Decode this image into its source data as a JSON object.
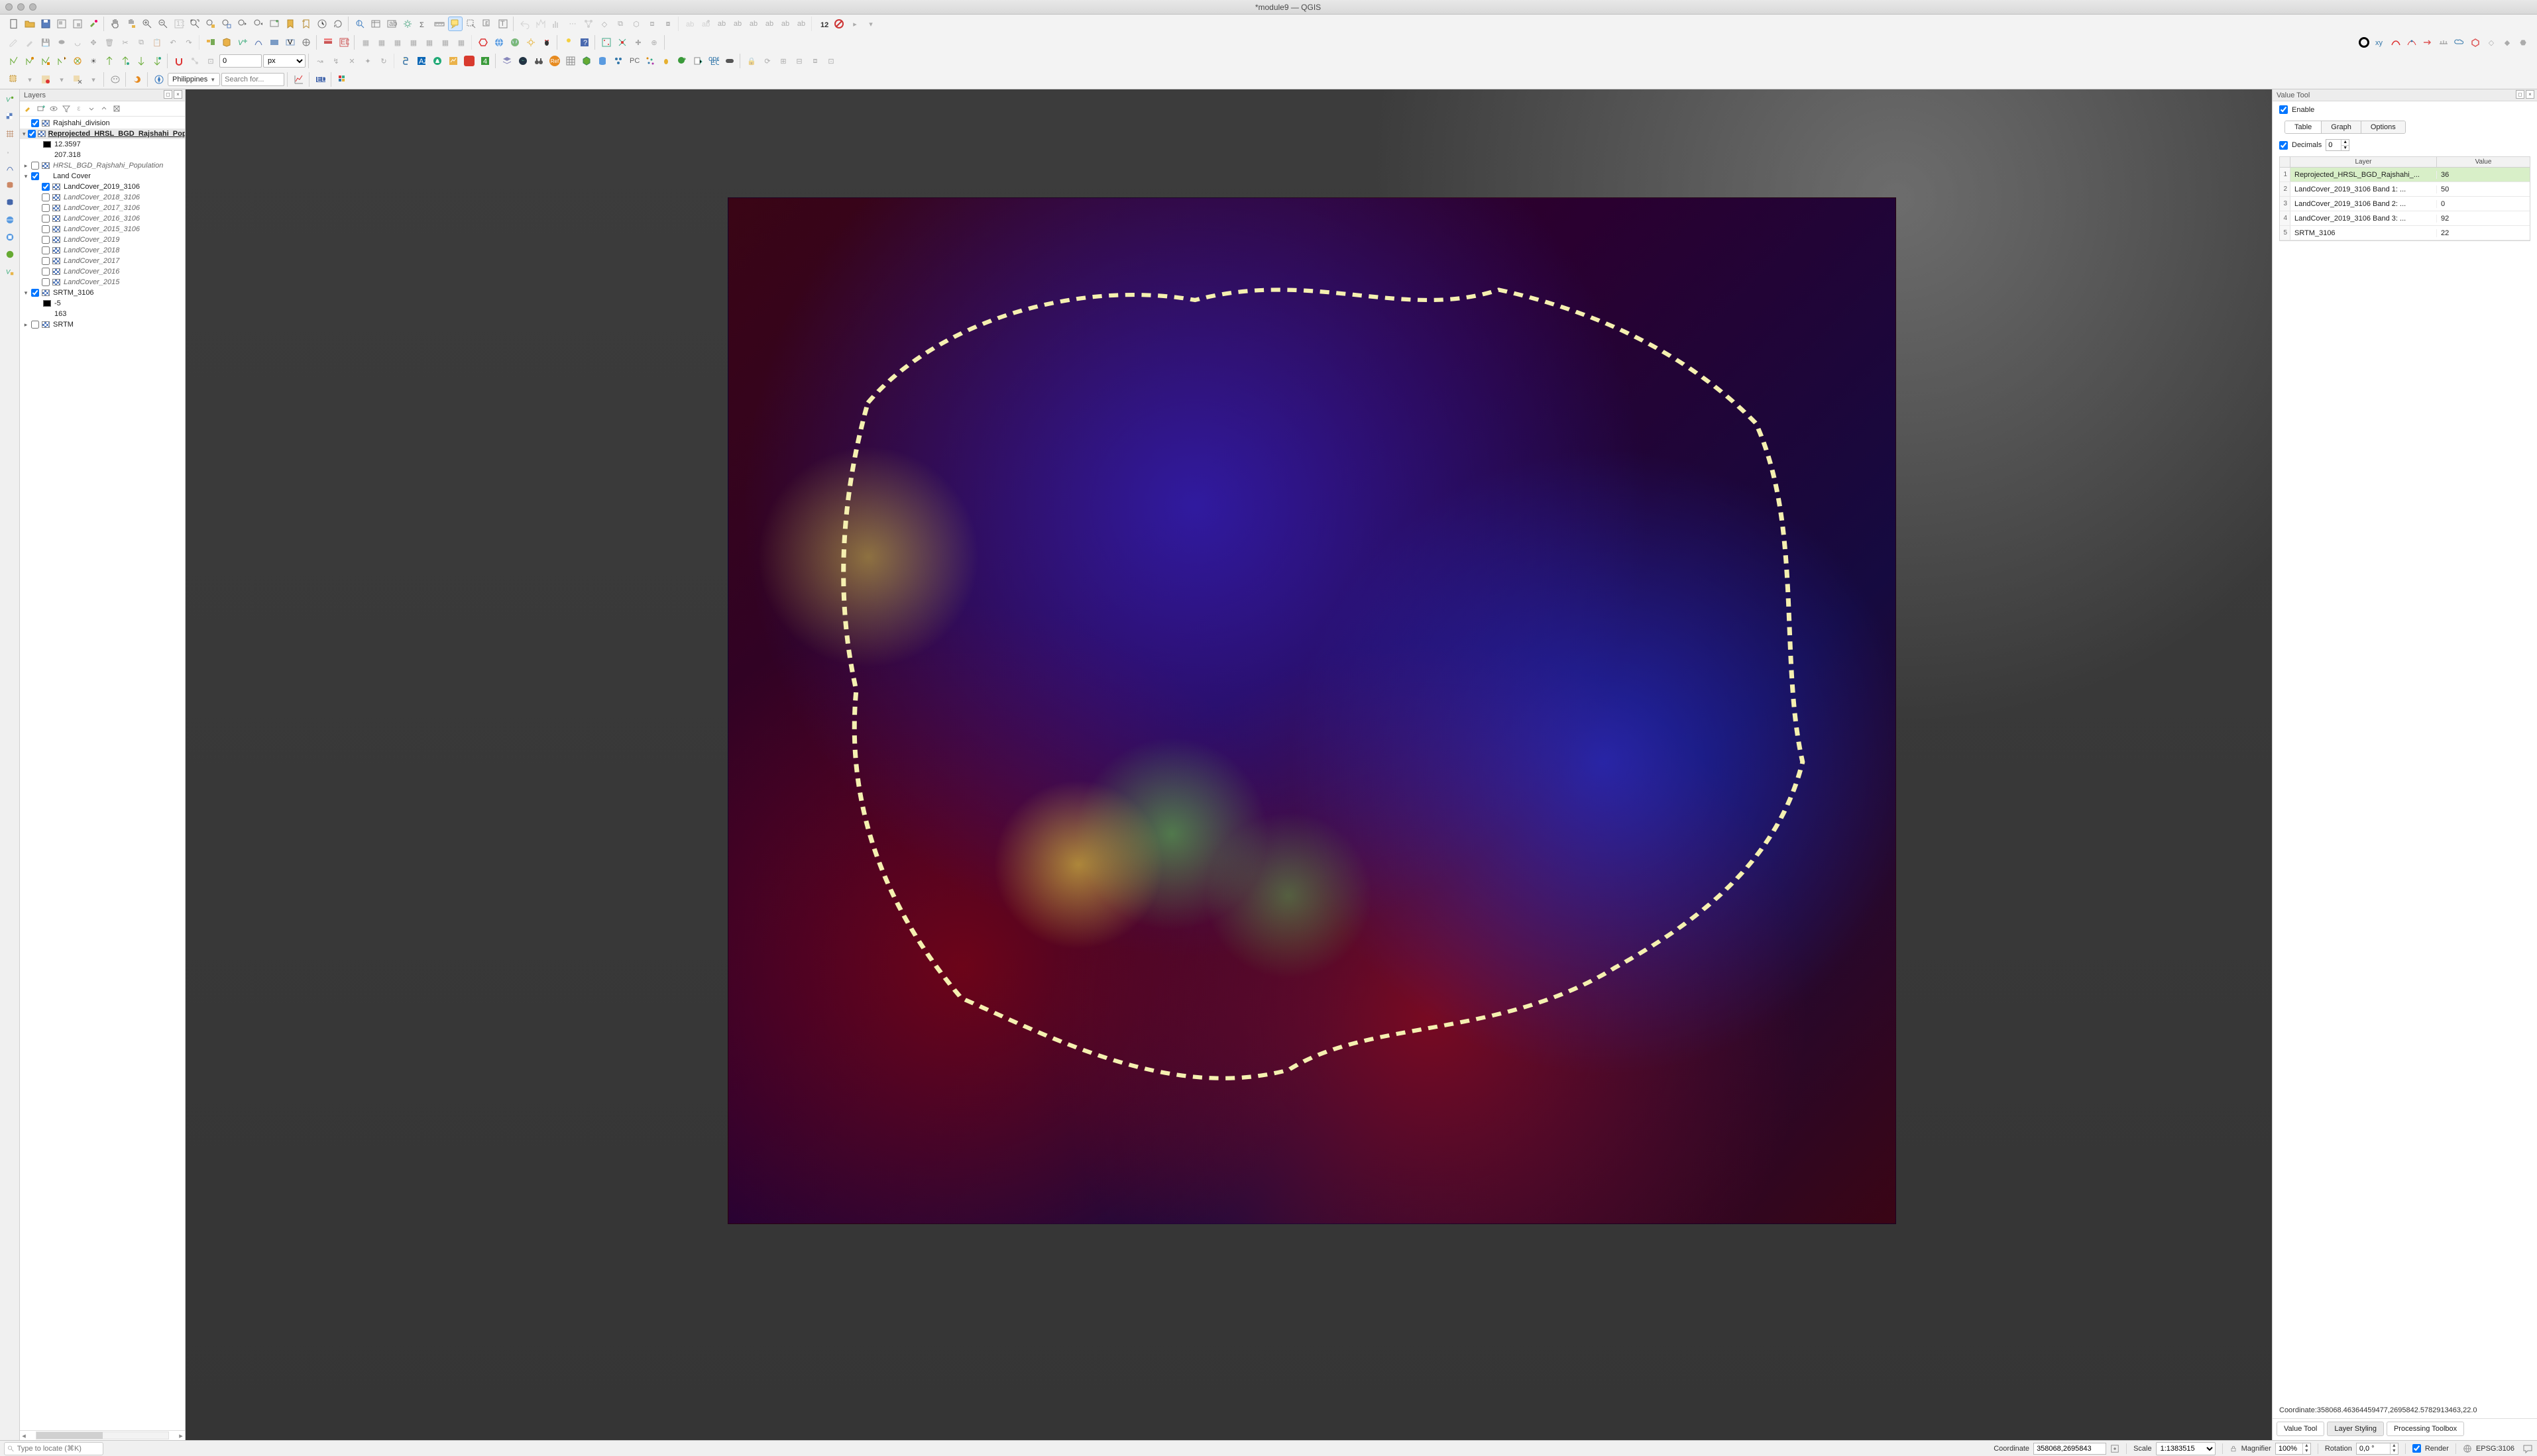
{
  "window": {
    "title": "*module9 — QGIS"
  },
  "toolbar4": {
    "num_input": "0",
    "unit": "px",
    "geom_filter": "Philippines",
    "search_placeholder": "Search for..."
  },
  "layers_panel": {
    "title": "Layers",
    "tree": [
      {
        "kind": "layer",
        "exp": "",
        "chk": true,
        "sym": "raster",
        "label": "Rajshahi_division",
        "cls": ""
      },
      {
        "kind": "layer",
        "exp": "▾",
        "chk": true,
        "sym": "raster",
        "label": "Reprojected_HRSL_BGD_Rajshahi_Population",
        "cls": "selected"
      },
      {
        "kind": "value",
        "swatch": "#000000",
        "label": "12.3597",
        "cls": "child2"
      },
      {
        "kind": "value",
        "swatch": "",
        "label": "207.318",
        "cls": "child2"
      },
      {
        "kind": "layer",
        "exp": "▸",
        "chk": false,
        "sym": "raster",
        "label": "HRSL_BGD_Rajshahi_Population",
        "cls": "italic"
      },
      {
        "kind": "group",
        "exp": "▾",
        "chk": true,
        "sym": "",
        "label": "Land Cover",
        "cls": ""
      },
      {
        "kind": "layer",
        "exp": "",
        "chk": true,
        "sym": "raster",
        "label": "LandCover_2019_3106",
        "cls": "child1"
      },
      {
        "kind": "layer",
        "exp": "",
        "chk": false,
        "sym": "raster",
        "label": "LandCover_2018_3106",
        "cls": "child1 italic"
      },
      {
        "kind": "layer",
        "exp": "",
        "chk": false,
        "sym": "raster",
        "label": "LandCover_2017_3106",
        "cls": "child1 italic"
      },
      {
        "kind": "layer",
        "exp": "",
        "chk": false,
        "sym": "raster",
        "label": "LandCover_2016_3106",
        "cls": "child1 italic"
      },
      {
        "kind": "layer",
        "exp": "",
        "chk": false,
        "sym": "raster",
        "label": "LandCover_2015_3106",
        "cls": "child1 italic"
      },
      {
        "kind": "layer",
        "exp": "",
        "chk": false,
        "sym": "raster",
        "label": "LandCover_2019",
        "cls": "child1 italic"
      },
      {
        "kind": "layer",
        "exp": "",
        "chk": false,
        "sym": "raster",
        "label": "LandCover_2018",
        "cls": "child1 italic"
      },
      {
        "kind": "layer",
        "exp": "",
        "chk": false,
        "sym": "raster",
        "label": "LandCover_2017",
        "cls": "child1 italic"
      },
      {
        "kind": "layer",
        "exp": "",
        "chk": false,
        "sym": "raster",
        "label": "LandCover_2016",
        "cls": "child1 italic"
      },
      {
        "kind": "layer",
        "exp": "",
        "chk": false,
        "sym": "raster",
        "label": "LandCover_2015",
        "cls": "child1 italic"
      },
      {
        "kind": "layer",
        "exp": "▾",
        "chk": true,
        "sym": "raster",
        "label": "SRTM_3106",
        "cls": ""
      },
      {
        "kind": "value",
        "swatch": "#000000",
        "label": "-5",
        "cls": "child2"
      },
      {
        "kind": "value",
        "swatch": "",
        "label": "163",
        "cls": "child2"
      },
      {
        "kind": "layer",
        "exp": "▸",
        "chk": false,
        "sym": "raster",
        "label": "SRTM",
        "cls": ""
      }
    ]
  },
  "value_tool": {
    "title": "Value Tool",
    "enable": true,
    "enable_label": "Enable",
    "tabs": {
      "table": "Table",
      "graph": "Graph",
      "options": "Options",
      "active": "table"
    },
    "decimals_label": "Decimals",
    "decimals": "0",
    "columns": {
      "layer": "Layer",
      "value": "Value"
    },
    "rows": [
      {
        "idx": "1",
        "layer": "Reprojected_HRSL_BGD_Rajshahi_...",
        "value": "36",
        "hl": true
      },
      {
        "idx": "2",
        "layer": "LandCover_2019_3106 Band 1: ...",
        "value": "50",
        "hl": false
      },
      {
        "idx": "3",
        "layer": "LandCover_2019_3106 Band 2: ...",
        "value": "0",
        "hl": false
      },
      {
        "idx": "4",
        "layer": "LandCover_2019_3106 Band 3: ...",
        "value": "92",
        "hl": false
      },
      {
        "idx": "5",
        "layer": "SRTM_3106",
        "value": "22",
        "hl": false
      }
    ],
    "coord_readout": "Coordinate:358068.46364459477,2695842.5782913463,22.0",
    "bottom_tabs": {
      "value_tool": "Value Tool",
      "layer_styling": "Layer Styling",
      "processing": "Processing Toolbox",
      "active": "layer_styling"
    }
  },
  "statusbar": {
    "locator_placeholder": "Type to locate (⌘K)",
    "coord_label": "Coordinate",
    "coord_value": "358068,2695843",
    "scale_label": "Scale",
    "scale_value": "1:1383515",
    "magnifier_label": "Magnifier",
    "magnifier_value": "100%",
    "rotation_label": "Rotation",
    "rotation_value": "0,0 °",
    "render_label": "Render",
    "crs": "EPSG:3106"
  }
}
